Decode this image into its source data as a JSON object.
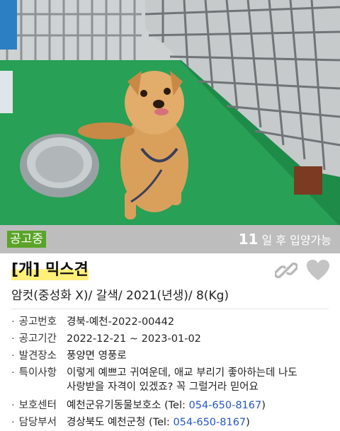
{
  "status": {
    "badge": "공고중",
    "days_number": "11",
    "days_suffix": "일 후 입양가능"
  },
  "animal": {
    "title": "[개] 믹스견",
    "summary": "암컷(중성화 X)/ 갈색/ 2021(년생)/ 8(Kg)"
  },
  "details": {
    "notice_no": {
      "label": "공고번호",
      "value": "경북-예천-2022-00442"
    },
    "period": {
      "label": "공고기간",
      "value": "2022-12-21 ~ 2023-01-02"
    },
    "place": {
      "label": "발견장소",
      "value": "풍양면 영풍로"
    },
    "notes": {
      "label": "특이사항",
      "line1": "이렇게 예쁘고 귀여운데, 애교 부리기 좋아하는데 나도",
      "line2": "사랑받을 자격이 있겠죠? 꼭 그럴거라 믿어요"
    },
    "center": {
      "label": "보호센터",
      "prefix": "예천군유기동물보호소 (Tel: ",
      "tel": "054-650-8167",
      "suffix": ")"
    },
    "dept": {
      "label": "담당부서",
      "prefix": "경상북도 예천군청 (Tel: ",
      "tel": "054-650-8167",
      "suffix": ")"
    }
  },
  "icons": {
    "share": "link-icon",
    "favorite": "heart-icon"
  },
  "colors": {
    "badge_bg": "#5aa428",
    "highlight": "#fff07a",
    "notice_no": "#f07a1e",
    "tel": "#2457c5"
  }
}
